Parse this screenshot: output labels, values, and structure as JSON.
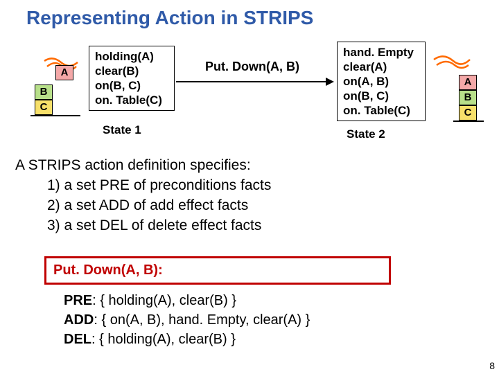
{
  "title": "Representing Action in STRIPS",
  "state1": {
    "predicates": "holding(A)\nclear(B)\non(B, C)\non. Table(C)",
    "label": "State 1",
    "blocks": {
      "a": "A",
      "b": "B",
      "c": "C"
    }
  },
  "action_label": "Put. Down(A, B)",
  "state2": {
    "predicates": "hand. Empty\nclear(A)\non(A, B)\non(B, C)\non. Table(C)",
    "label": "State 2",
    "blocks": {
      "a": "A",
      "b": "B",
      "c": "C"
    }
  },
  "body": {
    "line0": "A STRIPS action definition specifies:",
    "line1": "1) a set PRE of preconditions facts",
    "line2": "2) a set ADD of add effect facts",
    "line3": "3) a set DEL of delete effect facts"
  },
  "actdef": {
    "header": "Put. Down(A, B):",
    "pre_label": "PRE",
    "pre_val": ": { holding(A), clear(B) }",
    "add_label": "ADD",
    "add_val": ": { on(A, B), hand. Empty, clear(A) }",
    "del_label": "DEL",
    "del_val": ":  { holding(A), clear(B) }"
  },
  "page_number": "8"
}
